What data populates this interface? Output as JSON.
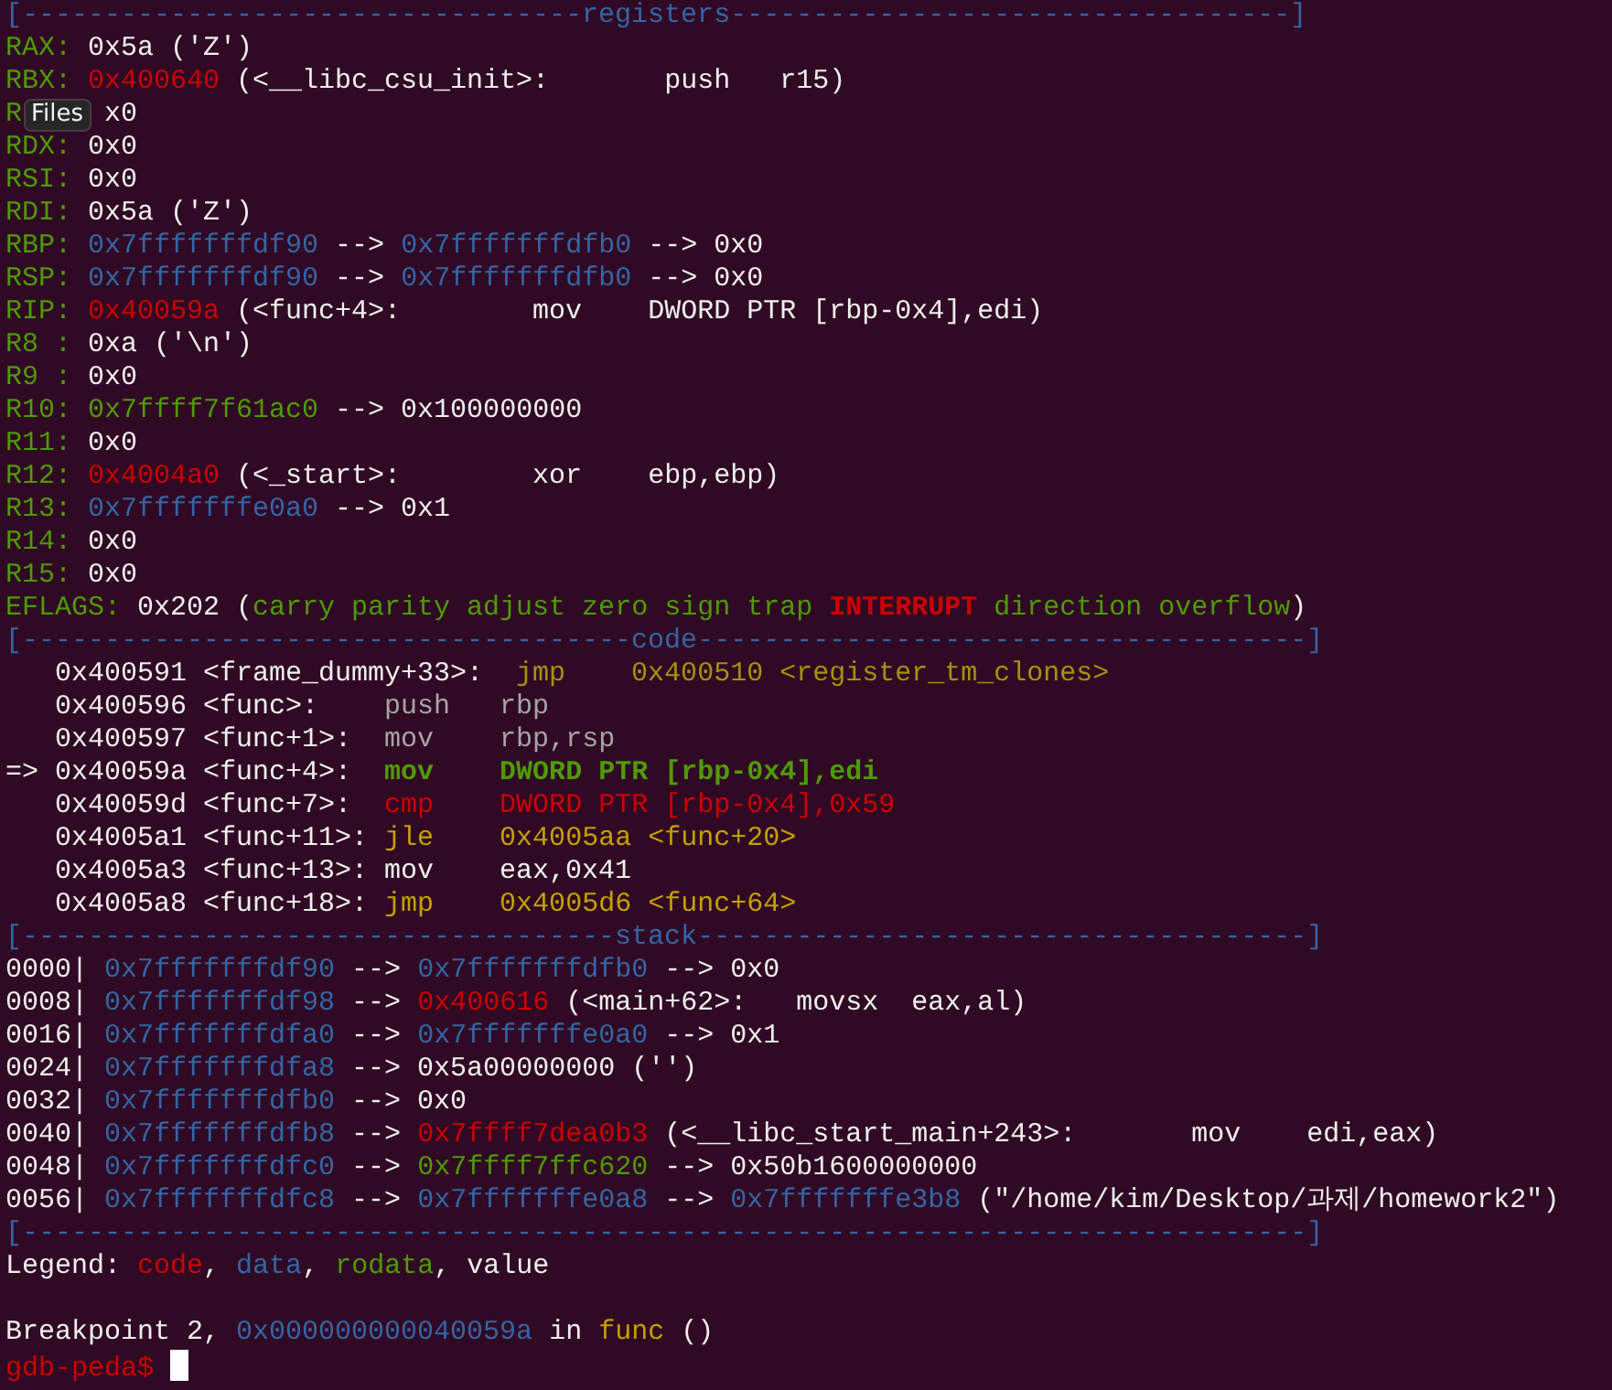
{
  "terminal": {
    "lines": [
      {
        "kind": "ruler",
        "segments": [
          {
            "text": "[----------------------------------registers----------------------------------]",
            "kind": "ruler"
          }
        ]
      },
      {
        "kind": "output",
        "segments": [
          {
            "text": "RAX: ",
            "kind": "reg"
          },
          {
            "text": "0x5a ('Z')",
            "kind": "text"
          }
        ]
      },
      {
        "kind": "output",
        "segments": [
          {
            "text": "RBX: ",
            "kind": "reg"
          },
          {
            "text": "0x400640",
            "kind": "code"
          },
          {
            "text": " (<__libc_csu_init>:       push   r15)",
            "kind": "text"
          }
        ]
      },
      {
        "kind": "output",
        "segments": [
          {
            "text": "R",
            "kind": "reg"
          },
          {
            "kind": "covered"
          },
          {
            "text": "x0",
            "kind": "text"
          }
        ]
      },
      {
        "kind": "output",
        "segments": [
          {
            "text": "RDX: ",
            "kind": "reg"
          },
          {
            "text": "0x0",
            "kind": "text"
          }
        ]
      },
      {
        "kind": "output",
        "segments": [
          {
            "text": "RSI: ",
            "kind": "reg"
          },
          {
            "text": "0x0",
            "kind": "text"
          }
        ]
      },
      {
        "kind": "output",
        "segments": [
          {
            "text": "RDI: ",
            "kind": "reg"
          },
          {
            "text": "0x5a ('Z')",
            "kind": "text"
          }
        ]
      },
      {
        "kind": "output",
        "segments": [
          {
            "text": "RBP: ",
            "kind": "reg"
          },
          {
            "text": "0x7fffffffdf90",
            "kind": "data"
          },
          {
            "text": " --> ",
            "kind": "text"
          },
          {
            "text": "0x7fffffffdfb0",
            "kind": "data"
          },
          {
            "text": " --> 0x0",
            "kind": "text"
          }
        ]
      },
      {
        "kind": "output",
        "segments": [
          {
            "text": "RSP: ",
            "kind": "reg"
          },
          {
            "text": "0x7fffffffdf90",
            "kind": "data"
          },
          {
            "text": " --> ",
            "kind": "text"
          },
          {
            "text": "0x7fffffffdfb0",
            "kind": "data"
          },
          {
            "text": " --> 0x0",
            "kind": "text"
          }
        ]
      },
      {
        "kind": "output",
        "segments": [
          {
            "text": "RIP: ",
            "kind": "reg"
          },
          {
            "text": "0x40059a",
            "kind": "code"
          },
          {
            "text": " (<func+4>:        mov    DWORD PTR [rbp-0x4],edi)",
            "kind": "text"
          }
        ]
      },
      {
        "kind": "output",
        "segments": [
          {
            "text": "R8 : ",
            "kind": "reg"
          },
          {
            "text": "0xa ('\\n')",
            "kind": "text"
          }
        ]
      },
      {
        "kind": "output",
        "segments": [
          {
            "text": "R9 : ",
            "kind": "reg"
          },
          {
            "text": "0x0",
            "kind": "text"
          }
        ]
      },
      {
        "kind": "output",
        "segments": [
          {
            "text": "R10: ",
            "kind": "reg"
          },
          {
            "text": "0x7ffff7f61ac0",
            "kind": "rodata"
          },
          {
            "text": " --> 0x100000000",
            "kind": "text"
          }
        ]
      },
      {
        "kind": "output",
        "segments": [
          {
            "text": "R11: ",
            "kind": "reg"
          },
          {
            "text": "0x0",
            "kind": "text"
          }
        ]
      },
      {
        "kind": "output",
        "segments": [
          {
            "text": "R12: ",
            "kind": "reg"
          },
          {
            "text": "0x4004a0",
            "kind": "code"
          },
          {
            "text": " (<_start>:        xor    ebp,ebp)",
            "kind": "text"
          }
        ]
      },
      {
        "kind": "output",
        "segments": [
          {
            "text": "R13: ",
            "kind": "reg"
          },
          {
            "text": "0x7fffffffe0a0",
            "kind": "data"
          },
          {
            "text": " --> 0x1",
            "kind": "text"
          }
        ]
      },
      {
        "kind": "output",
        "segments": [
          {
            "text": "R14: ",
            "kind": "reg"
          },
          {
            "text": "0x0",
            "kind": "text"
          }
        ]
      },
      {
        "kind": "output",
        "segments": [
          {
            "text": "R15: ",
            "kind": "reg"
          },
          {
            "text": "0x0",
            "kind": "text"
          }
        ]
      },
      {
        "kind": "output",
        "segments": [
          {
            "text": "EFLAGS: ",
            "kind": "reg"
          },
          {
            "text": "0x202 (",
            "kind": "text"
          },
          {
            "text": "carry parity adjust zero sign trap ",
            "kind": "rodata"
          },
          {
            "text": "INTERRUPT",
            "kind": "alert"
          },
          {
            "text": " direction overflow",
            "kind": "rodata"
          },
          {
            "text": ")",
            "kind": "text"
          }
        ]
      },
      {
        "kind": "ruler",
        "segments": [
          {
            "text": "[-------------------------------------code-------------------------------------]",
            "kind": "ruler"
          }
        ]
      },
      {
        "kind": "output",
        "segments": [
          {
            "text": "   0x400591 <frame_dummy+33>:  ",
            "kind": "text"
          },
          {
            "text": "jmp    0x400510 <register_tm_clones>",
            "kind": "dimyellow"
          }
        ]
      },
      {
        "kind": "output",
        "segments": [
          {
            "text": "   0x400596 <func>:    ",
            "kind": "text"
          },
          {
            "text": "push   rbp",
            "kind": "dim"
          }
        ]
      },
      {
        "kind": "output",
        "segments": [
          {
            "text": "   0x400597 <func+1>:  ",
            "kind": "text"
          },
          {
            "text": "mov    rbp,rsp",
            "kind": "dim"
          }
        ]
      },
      {
        "kind": "output",
        "segments": [
          {
            "text": "=> 0x40059a <func+4>:  ",
            "kind": "text"
          },
          {
            "text": "mov    DWORD PTR [rbp-0x4],edi",
            "kind": "current"
          }
        ]
      },
      {
        "kind": "output",
        "segments": [
          {
            "text": "   0x40059d <func+7>:  ",
            "kind": "text"
          },
          {
            "text": "cmp    DWORD PTR [rbp-0x4],0x59",
            "kind": "code"
          }
        ]
      },
      {
        "kind": "output",
        "segments": [
          {
            "text": "   0x4005a1 <func+11>: ",
            "kind": "text"
          },
          {
            "text": "jle    0x4005aa <func+20>",
            "kind": "yellow"
          }
        ]
      },
      {
        "kind": "output",
        "segments": [
          {
            "text": "   0x4005a3 <func+13>: mov    eax,0x41",
            "kind": "text"
          }
        ]
      },
      {
        "kind": "output",
        "segments": [
          {
            "text": "   0x4005a8 <func+18>: ",
            "kind": "text"
          },
          {
            "text": "jmp    0x4005d6 <func+64>",
            "kind": "yellow"
          }
        ]
      },
      {
        "kind": "ruler",
        "segments": [
          {
            "text": "[------------------------------------stack-------------------------------------]",
            "kind": "ruler"
          }
        ]
      },
      {
        "kind": "output",
        "segments": [
          {
            "text": "0000| ",
            "kind": "text"
          },
          {
            "text": "0x7fffffffdf90",
            "kind": "data"
          },
          {
            "text": " --> ",
            "kind": "text"
          },
          {
            "text": "0x7fffffffdfb0",
            "kind": "data"
          },
          {
            "text": " --> 0x0",
            "kind": "text"
          }
        ]
      },
      {
        "kind": "output",
        "segments": [
          {
            "text": "0008| ",
            "kind": "text"
          },
          {
            "text": "0x7fffffffdf98",
            "kind": "data"
          },
          {
            "text": " --> ",
            "kind": "text"
          },
          {
            "text": "0x400616",
            "kind": "code"
          },
          {
            "text": " (<main+62>:   movsx  eax,al)",
            "kind": "text"
          }
        ]
      },
      {
        "kind": "output",
        "segments": [
          {
            "text": "0016| ",
            "kind": "text"
          },
          {
            "text": "0x7fffffffdfa0",
            "kind": "data"
          },
          {
            "text": " --> ",
            "kind": "text"
          },
          {
            "text": "0x7fffffffe0a0",
            "kind": "data"
          },
          {
            "text": " --> 0x1",
            "kind": "text"
          }
        ]
      },
      {
        "kind": "output",
        "segments": [
          {
            "text": "0024| ",
            "kind": "text"
          },
          {
            "text": "0x7fffffffdfa8",
            "kind": "data"
          },
          {
            "text": " --> 0x5a00000000 ('')",
            "kind": "text"
          }
        ]
      },
      {
        "kind": "output",
        "segments": [
          {
            "text": "0032| ",
            "kind": "text"
          },
          {
            "text": "0x7fffffffdfb0",
            "kind": "data"
          },
          {
            "text": " --> 0x0",
            "kind": "text"
          }
        ]
      },
      {
        "kind": "output",
        "segments": [
          {
            "text": "0040| ",
            "kind": "text"
          },
          {
            "text": "0x7fffffffdfb8",
            "kind": "data"
          },
          {
            "text": " --> ",
            "kind": "text"
          },
          {
            "text": "0x7ffff7dea0b3",
            "kind": "code"
          },
          {
            "text": " (<__libc_start_main+243>:       mov    edi,eax)",
            "kind": "text"
          }
        ]
      },
      {
        "kind": "output",
        "segments": [
          {
            "text": "0048| ",
            "kind": "text"
          },
          {
            "text": "0x7fffffffdfc0",
            "kind": "data"
          },
          {
            "text": " --> ",
            "kind": "text"
          },
          {
            "text": "0x7ffff7ffc620",
            "kind": "rodata"
          },
          {
            "text": " --> 0x50b1600000000",
            "kind": "text"
          }
        ]
      },
      {
        "kind": "output",
        "segments": [
          {
            "text": "0056| ",
            "kind": "text"
          },
          {
            "text": "0x7fffffffdfc8",
            "kind": "data"
          },
          {
            "text": " --> ",
            "kind": "text"
          },
          {
            "text": "0x7fffffffe0a8",
            "kind": "data"
          },
          {
            "text": " --> ",
            "kind": "text"
          },
          {
            "text": "0x7fffffffe3b8",
            "kind": "data"
          },
          {
            "text": " (\"/home/kim/Desktop/과제/homework2\")",
            "kind": "text"
          }
        ]
      },
      {
        "kind": "ruler",
        "segments": [
          {
            "text": "[------------------------------------------------------------------------------]",
            "kind": "ruler"
          }
        ]
      },
      {
        "kind": "output",
        "segments": [
          {
            "text": "Legend: ",
            "kind": "text"
          },
          {
            "text": "code",
            "kind": "code"
          },
          {
            "text": ", ",
            "kind": "text"
          },
          {
            "text": "data",
            "kind": "data"
          },
          {
            "text": ", ",
            "kind": "text"
          },
          {
            "text": "rodata",
            "kind": "rodata"
          },
          {
            "text": ", value",
            "kind": "text"
          }
        ]
      },
      {
        "kind": "blank"
      },
      {
        "kind": "output",
        "segments": [
          {
            "text": "Breakpoint 2, ",
            "kind": "text"
          },
          {
            "text": "0x000000000040059a",
            "kind": "data"
          },
          {
            "text": " in ",
            "kind": "text"
          },
          {
            "text": "func",
            "kind": "yellow"
          },
          {
            "text": " ()",
            "kind": "text"
          }
        ]
      },
      {
        "kind": "prompt",
        "segments": [
          {
            "text": "gdb-peda$ ",
            "kind": "code"
          }
        ]
      }
    ]
  },
  "tooltip": {
    "text": "Files"
  }
}
